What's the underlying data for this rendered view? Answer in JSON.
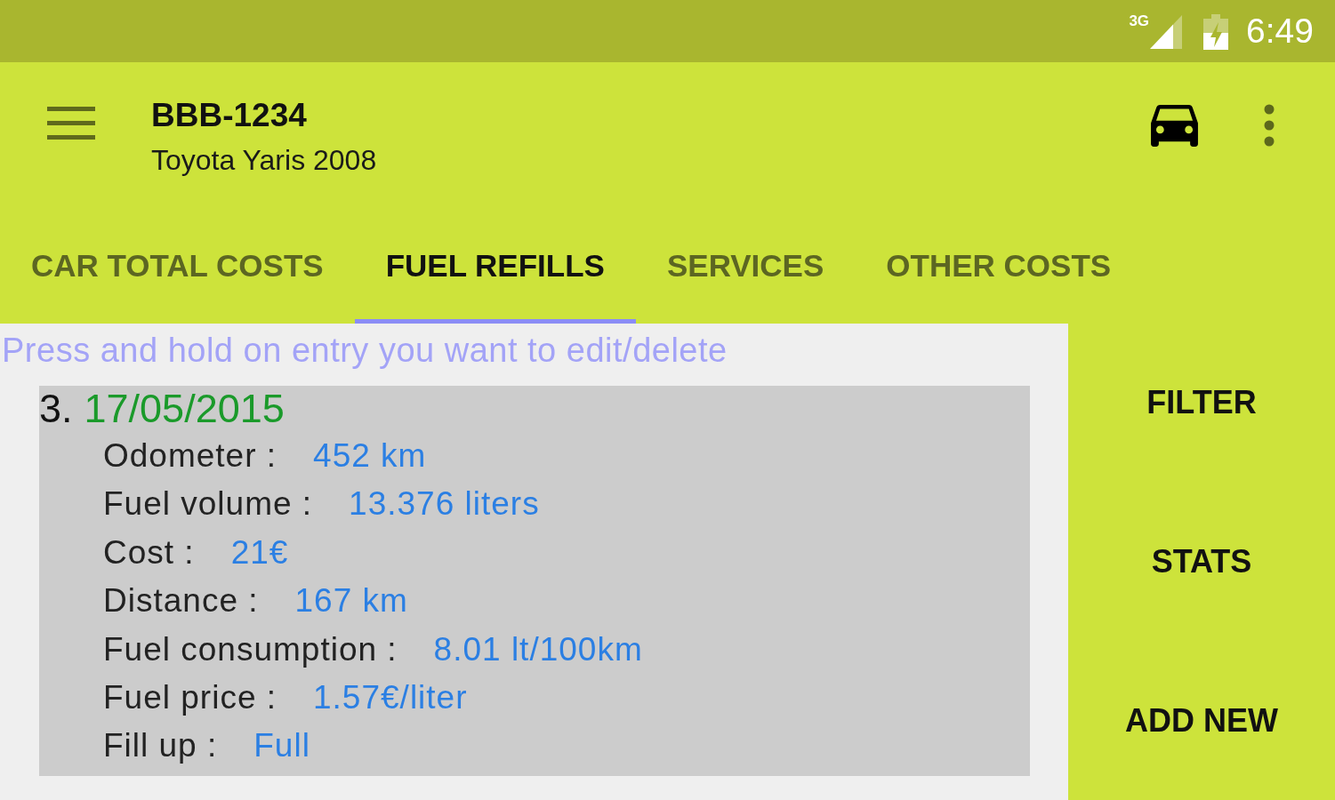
{
  "status_bar": {
    "network": "3G",
    "time": "6:49"
  },
  "app_bar": {
    "title": "BBB-1234",
    "subtitle": "Toyota Yaris 2008"
  },
  "tabs": [
    {
      "label": "CAR TOTAL COSTS",
      "selected": false
    },
    {
      "label": "FUEL REFILLS",
      "selected": true
    },
    {
      "label": "SERVICES",
      "selected": false
    },
    {
      "label": "OTHER COSTS",
      "selected": false
    }
  ],
  "hint": "Press and hold on entry you want to edit/delete",
  "entries": [
    {
      "number": "3.",
      "date": "17/05/2015",
      "fields": [
        {
          "label": "Odometer :",
          "value": "452 km"
        },
        {
          "label": "Fuel volume :",
          "value": "13.376 liters"
        },
        {
          "label": "Cost :",
          "value": "21€"
        },
        {
          "label": "Distance :",
          "value": "167 km"
        },
        {
          "label": "Fuel consumption :",
          "value": "8.01 lt/100km"
        },
        {
          "label": "Fuel price :",
          "value": "1.57€/liter"
        },
        {
          "label": "Fill up :",
          "value": "Full"
        }
      ]
    }
  ],
  "actions": [
    "FILTER",
    "STATS",
    "ADD NEW"
  ]
}
